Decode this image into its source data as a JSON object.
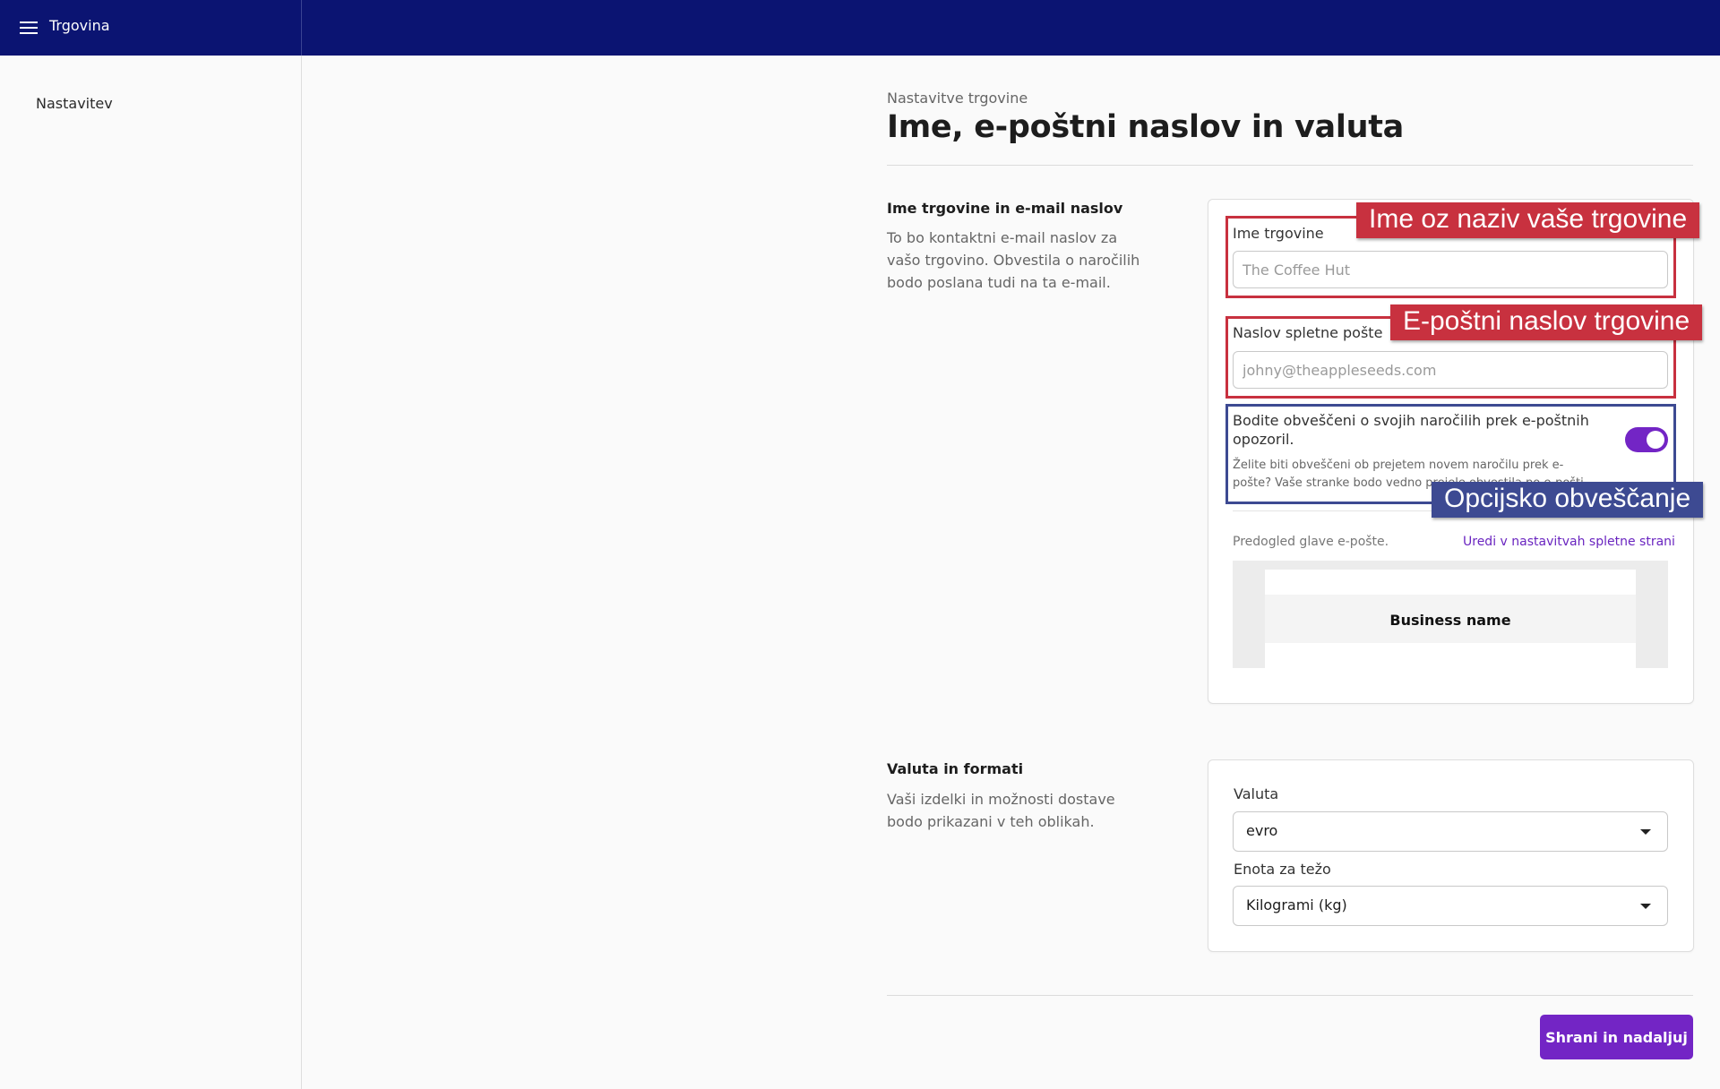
{
  "header": {
    "title": "Trgovina"
  },
  "sidebar": {
    "items": [
      {
        "label": "Nastavitev"
      }
    ]
  },
  "page": {
    "breadcrumb": "Nastavitve trgovine",
    "title": "Ime, e-poštni naslov in valuta"
  },
  "store_section": {
    "title": "Ime trgovine in e-mail naslov",
    "description": "To bo kontaktni e-mail naslov za vašo trgovino. Obvestila o naročilih bodo poslana tudi na ta e-mail.",
    "store_name": {
      "label": "Ime trgovine",
      "placeholder": "The Coffee Hut",
      "value": ""
    },
    "email": {
      "label": "Naslov spletne pošte",
      "placeholder": "johny@theappleseeds.com",
      "value": ""
    },
    "notifications": {
      "title": "Bodite obveščeni o svojih naročilih prek e-poštnih opozoril.",
      "description": "Želite biti obveščeni ob prejetem novem naročilu prek e-pošte? Vaše stranke bodo vedno prejele obvestila po e-pošti.",
      "enabled": true
    },
    "preview": {
      "label": "Predogled glave e-pošte.",
      "link": "Uredi v nastavitvah spletne strani",
      "business_name": "Business name"
    }
  },
  "annotations": {
    "store_name": "Ime oz naziv vaše trgovine",
    "email": "E-poštni naslov trgovine",
    "notifications": "Opcijsko obveščanje"
  },
  "currency_section": {
    "title": "Valuta in formati",
    "description": "Vaši izdelki in možnosti dostave bodo prikazani v teh oblikah.",
    "currency": {
      "label": "Valuta",
      "value": "evro"
    },
    "weight_unit": {
      "label": "Enota za težo",
      "value": "Kilogrami (kg)"
    }
  },
  "actions": {
    "save_label": "Shrani in nadaljuj"
  },
  "colors": {
    "header_bg": "#0b1472",
    "accent": "#7325c5",
    "annotation_red": "#c8313f",
    "annotation_blue": "#3d4a92"
  }
}
